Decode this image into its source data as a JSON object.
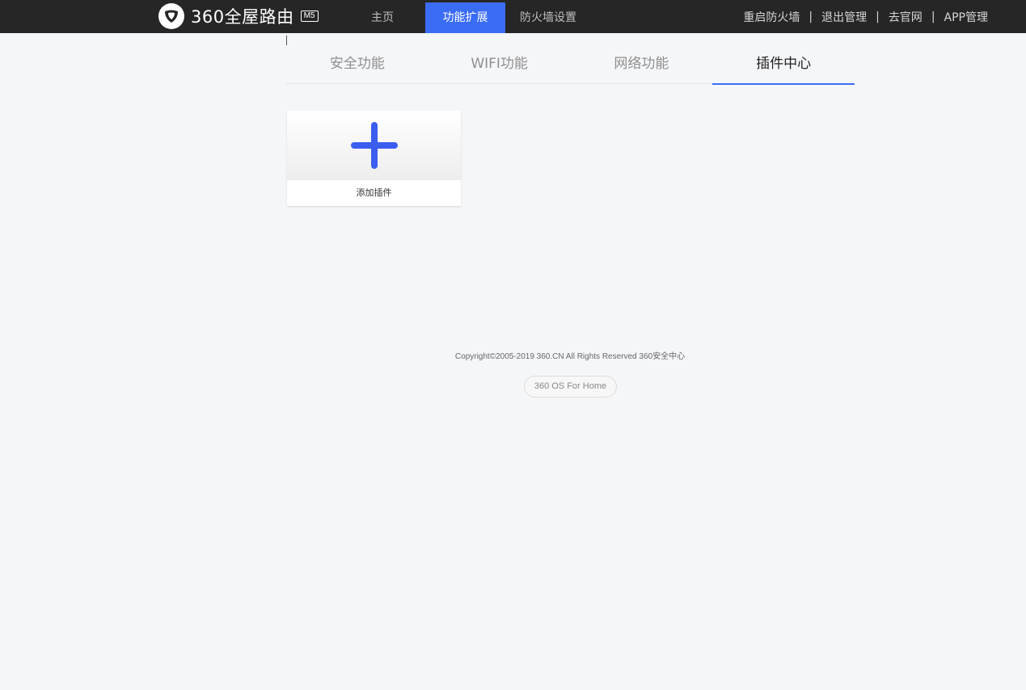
{
  "header": {
    "brand": "360全屋路由",
    "model": "M5",
    "nav": [
      {
        "label": "主页",
        "active": false
      },
      {
        "label": "功能扩展",
        "active": true
      },
      {
        "label": "防火墙设置",
        "active": false
      }
    ],
    "links": [
      "重启防火墙",
      "退出管理",
      "去官网",
      "APP管理"
    ],
    "separator": "|"
  },
  "tabs": [
    {
      "label": "安全功能",
      "active": false
    },
    {
      "label": "WIFI功能",
      "active": false
    },
    {
      "label": "网络功能",
      "active": false
    },
    {
      "label": "插件中心",
      "active": true
    }
  ],
  "plugin_card": {
    "label": "添加插件",
    "icon": "plus-icon"
  },
  "footer": {
    "copyright": "Copyright©2005-2019 360.CN All Rights Reserved 360安全中心",
    "os_label": "360 OS For Home"
  },
  "colors": {
    "accent": "#3b6cf6",
    "topbar": "#262626",
    "background": "#f5f6f8"
  }
}
